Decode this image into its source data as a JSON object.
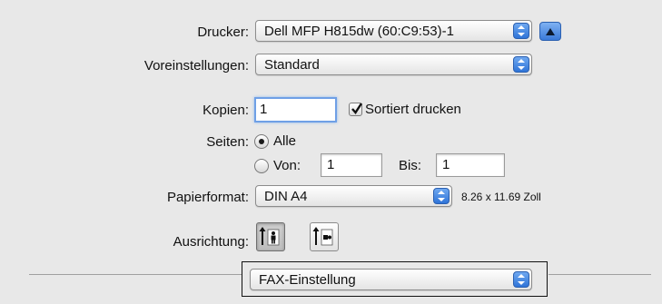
{
  "printer": {
    "label": "Drucker:",
    "value": "Dell MFP H815dw (60:C9:53)-1"
  },
  "presets": {
    "label": "Voreinstellungen:",
    "value": "Standard"
  },
  "copies": {
    "label": "Kopien:",
    "value": "1",
    "collate_label": "Sortiert drucken",
    "collate_checked": true
  },
  "pages": {
    "label": "Seiten:",
    "all_label": "Alle",
    "from_label": "Von:",
    "from_value": "1",
    "to_label": "Bis:",
    "to_value": "1",
    "selected": "all"
  },
  "paper": {
    "label": "Papierformat:",
    "value": "DIN A4",
    "size_text": "8.26 x 11.69 Zoll"
  },
  "orientation": {
    "label": "Ausrichtung:",
    "options": [
      "portrait",
      "landscape"
    ],
    "selected": "portrait"
  },
  "section": {
    "value": "FAX-Einstellung"
  },
  "colors": {
    "background": "#e8e8e8",
    "accent": "#2f74d8"
  },
  "icons": {
    "stepper": "up-down-arrows-icon",
    "details": "disclosure-triangle-up-icon",
    "portrait": "portrait-orientation-icon",
    "landscape": "landscape-orientation-icon"
  }
}
